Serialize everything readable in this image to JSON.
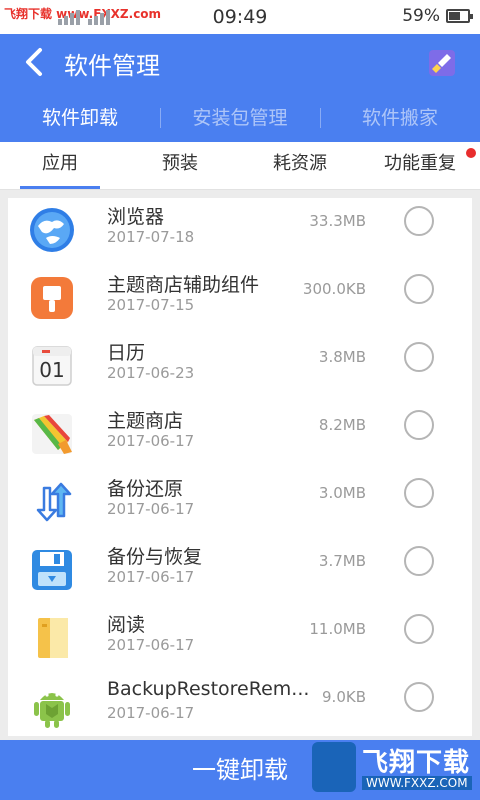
{
  "status": {
    "watermark": "飞翔下载 www.FXXZ.com",
    "time": "09:49",
    "battery": "59%",
    "battery_level": 0.59
  },
  "header": {
    "title": "软件管理",
    "tabs": [
      "软件卸载",
      "安装包管理",
      "软件搬家"
    ]
  },
  "subtabs": [
    "应用",
    "预装",
    "耗资源",
    "功能重复"
  ],
  "apps": [
    {
      "name": "浏览器",
      "date": "2017-07-18",
      "size": "33.3MB",
      "icon": "browser-icon"
    },
    {
      "name": "主题商店辅助组件",
      "date": "2017-07-15",
      "size": "300.0KB",
      "icon": "theme-helper-icon"
    },
    {
      "name": "日历",
      "date": "2017-06-23",
      "size": "3.8MB",
      "icon": "calendar-icon"
    },
    {
      "name": "主题商店",
      "date": "2017-06-17",
      "size": "8.2MB",
      "icon": "theme-store-icon"
    },
    {
      "name": "备份还原",
      "date": "2017-06-17",
      "size": "3.0MB",
      "icon": "backup-restore-icon"
    },
    {
      "name": "备份与恢复",
      "date": "2017-06-17",
      "size": "3.7MB",
      "icon": "backup-recover-icon"
    },
    {
      "name": "阅读",
      "date": "2017-06-17",
      "size": "11.0MB",
      "icon": "reader-icon"
    },
    {
      "name": "BackupRestoreRem...",
      "date": "2017-06-17",
      "size": "9.0KB",
      "icon": "android-icon"
    }
  ],
  "calendar_day": "01",
  "bottom": {
    "uninstall_label": "一键卸载",
    "watermark_title": "飞翔下载",
    "watermark_url": "WWW.FXXZ.COM"
  },
  "colors": {
    "accent": "#4a7ff0",
    "alert": "#e82d2d"
  }
}
